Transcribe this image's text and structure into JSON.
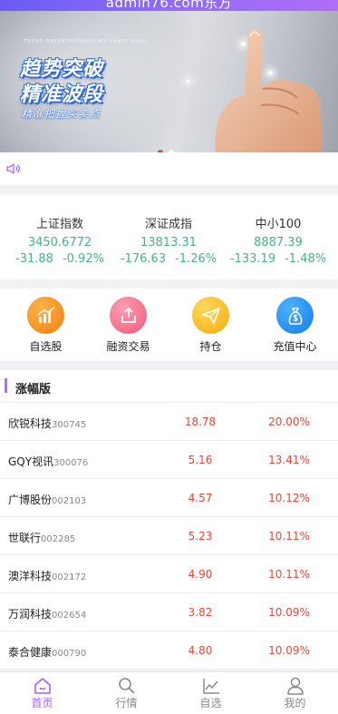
{
  "header": {
    "title": "admin76.com东方"
  },
  "banner": {
    "small_text": "TREND BREAKTHROUGH ACCURATE BAND",
    "title_line1": "趋势突破",
    "title_line2": "精准波段",
    "subtitle": "精准把握买卖点",
    "slides": 2,
    "active_slide": 1
  },
  "notice": {
    "icon": "speaker-icon",
    "text": ""
  },
  "indices": [
    {
      "name": "上证指数",
      "value": "3450.6772",
      "change": "-31.88",
      "percent": "-0.92%"
    },
    {
      "name": "深证成指",
      "value": "13813.31",
      "change": "-176.63",
      "percent": "-1.26%"
    },
    {
      "name": "中小100",
      "value": "8887.39",
      "change": "-133.19",
      "percent": "-1.48%"
    }
  ],
  "quick_menu": [
    {
      "label": "自选股",
      "icon": "chart-bars-icon",
      "color": "#f08a1c"
    },
    {
      "label": "融资交易",
      "icon": "upload-arrow-icon",
      "color": "#f06b87"
    },
    {
      "label": "持仓",
      "icon": "paper-plane-icon",
      "color": "#f7b81a"
    },
    {
      "label": "充值中心",
      "icon": "money-bag-icon",
      "color": "#1f8ef0"
    }
  ],
  "ranking": {
    "title": "涨幅版",
    "rows": [
      {
        "name": "欣锐科技",
        "code": "300745",
        "price": "18.78",
        "percent": "20.00%"
      },
      {
        "name": "GQY视讯",
        "code": "300076",
        "price": "5.16",
        "percent": "13.41%"
      },
      {
        "name": "广博股份",
        "code": "002103",
        "price": "4.57",
        "percent": "10.12%"
      },
      {
        "name": "世联行",
        "code": "002285",
        "price": "5.23",
        "percent": "10.11%"
      },
      {
        "name": "澳洋科技",
        "code": "002172",
        "price": "4.90",
        "percent": "10.11%"
      },
      {
        "name": "万润科技",
        "code": "002654",
        "price": "3.82",
        "percent": "10.09%"
      },
      {
        "name": "泰合健康",
        "code": "000790",
        "price": "4.80",
        "percent": "10.09%"
      }
    ]
  },
  "tabbar": [
    {
      "label": "首页",
      "icon": "home-icon",
      "active": true
    },
    {
      "label": "行情",
      "icon": "search-icon",
      "active": false
    },
    {
      "label": "自选",
      "icon": "line-chart-icon",
      "active": false
    },
    {
      "label": "我的",
      "icon": "user-icon",
      "active": false
    }
  ],
  "colors": {
    "accent": "#a762f0",
    "down": "#47b38a",
    "up": "#e2483d"
  }
}
